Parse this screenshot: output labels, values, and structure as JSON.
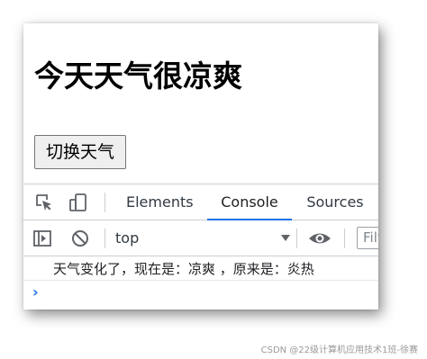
{
  "page": {
    "heading": "今天天气很凉爽",
    "switch_button_label": "切换天气"
  },
  "devtools": {
    "tabs": [
      {
        "label": "Elements",
        "active": false
      },
      {
        "label": "Console",
        "active": true
      },
      {
        "label": "Sources",
        "active": false
      }
    ],
    "toolbar": {
      "context": "top",
      "filter_text": "Filt"
    },
    "console": {
      "messages": [
        "天气变化了，现在是：凉爽 ，原来是：炎热"
      ],
      "prompt_symbol": "›"
    },
    "icons": {
      "inspect": "inspect-element-icon",
      "device": "device-toolbar-icon",
      "sidebar": "console-sidebar-icon",
      "clear": "clear-console-icon",
      "eye": "live-expression-eye-icon"
    },
    "colors": {
      "accent": "#1a73e8",
      "icon": "#5f6368"
    }
  },
  "watermark": "CSDN @22级计算机应用技术1班-徐赛"
}
